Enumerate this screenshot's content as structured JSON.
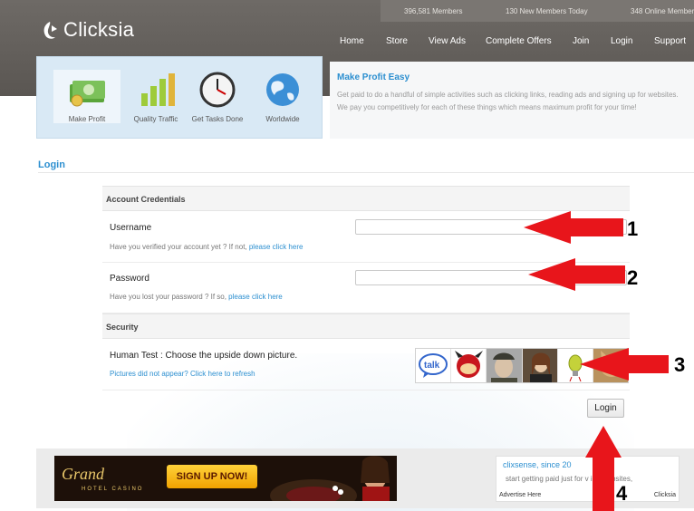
{
  "header": {
    "brand": "Clicksia",
    "stats": [
      "396,581 Members",
      "130 New Members Today",
      "348 Online Members"
    ],
    "nav": [
      "Home",
      "Store",
      "View Ads",
      "Complete Offers",
      "Join",
      "Login",
      "Support"
    ]
  },
  "features": [
    {
      "label": "Make Profit",
      "icon": "money-stack-icon"
    },
    {
      "label": "Quality Traffic",
      "icon": "bar-chart-icon"
    },
    {
      "label": "Get Tasks Done",
      "icon": "clock-icon"
    },
    {
      "label": "Worldwide",
      "icon": "globe-icon"
    }
  ],
  "about": {
    "title": "Make Profit Easy",
    "text": "Get paid to do a handful of simple activities such as clicking links, reading ads and signing up for websites. We pay you competitively for each of these things which means maximum profit for your time!"
  },
  "page_title": "Login",
  "form": {
    "section_credentials": "Account Credentials",
    "username_label": "Username",
    "username_hint": "Have you verified your account yet ? If not, ",
    "username_hint_link": "please click here",
    "password_label": "Password",
    "password_hint": "Have you lost your password ? If so, ",
    "password_hint_link": "please click here",
    "section_security": "Security",
    "human_test_label": "Human Test : Choose the upside down picture.",
    "refresh_link": "Pictures did not appear? Click here to refresh",
    "captcha_images": [
      "talk-logo",
      "cartoon-character",
      "soldier-portrait",
      "young-wizard",
      "lightbulb",
      "cat"
    ],
    "login_button": "Login"
  },
  "annotations": [
    "1",
    "2",
    "3",
    "4"
  ],
  "annotation_color": "#e8151b",
  "ads": {
    "banner_brand": "Grand",
    "banner_sub": "HOTEL CASINO",
    "banner_cta": "SIGN UP NOW!",
    "text_ad_title": "clixsense, since 20",
    "text_ad_desc": "start getting paid just for v      ing websites,",
    "advertise_here": "Advertise Here",
    "advertise_brand": "Clicksia"
  }
}
